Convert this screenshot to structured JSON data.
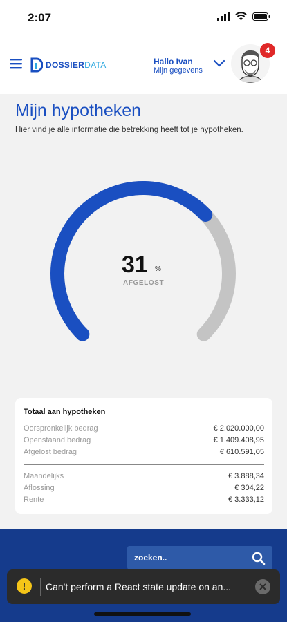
{
  "status": {
    "time": "2:07",
    "icons": [
      "signal-icon",
      "wifi-icon",
      "battery-icon"
    ]
  },
  "header": {
    "logo_part1": "DOSSIER",
    "logo_part2": "DATA",
    "greeting": "Hallo Ivan",
    "sub": "Mijn gegevens",
    "notification_count": "4"
  },
  "page": {
    "title": "Mijn hypotheken",
    "intro": "Hier vind je alle informatie die betrekking heeft tot je hypotheken."
  },
  "gauge": {
    "value": "31",
    "unit": "%",
    "label": "AFGELOST",
    "percent": 31
  },
  "summary": {
    "title": "Totaal aan hypotheken",
    "rows": [
      {
        "label": "Oorspronkelijk bedrag",
        "value": "€ 2.020.000,00"
      },
      {
        "label": "Openstaand bedrag",
        "value": "€ 1.409.408,95"
      },
      {
        "label": "Afgelost bedrag",
        "value": "€ 610.591,05"
      }
    ],
    "rows2": [
      {
        "label": "Maandelijks",
        "value": "€ 3.888,34"
      },
      {
        "label": "Aflossing",
        "value": "€ 304,22"
      },
      {
        "label": "Rente",
        "value": "€ 3.333,12"
      }
    ]
  },
  "footer": {
    "search_placeholder": "zoeken.."
  },
  "toast": {
    "message": "Can't perform a React state update on an..."
  },
  "colors": {
    "primary": "#1a4fc1",
    "gauge_track": "#c4c4c4",
    "footer": "#153b8c",
    "badge": "#e02828",
    "warning": "#f5c518"
  }
}
